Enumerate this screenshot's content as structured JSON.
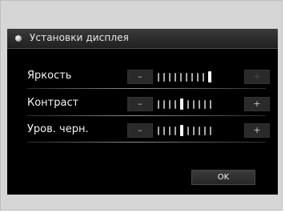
{
  "window": {
    "title": "Установки дисплея"
  },
  "settings": [
    {
      "label": "Яркость",
      "minus": "–",
      "plus": "+",
      "value": 10,
      "max": 10,
      "plus_disabled": true
    },
    {
      "label": "Контраст",
      "minus": "–",
      "plus": "+",
      "value": 5,
      "max": 10,
      "plus_disabled": false
    },
    {
      "label": "Уров. черн.",
      "minus": "–",
      "plus": "+",
      "value": 5,
      "max": 10,
      "plus_disabled": false
    }
  ],
  "ok_label": "OK",
  "colors": {
    "background": "#000000",
    "text": "#f4f4f4",
    "ok_button": "#303030"
  }
}
